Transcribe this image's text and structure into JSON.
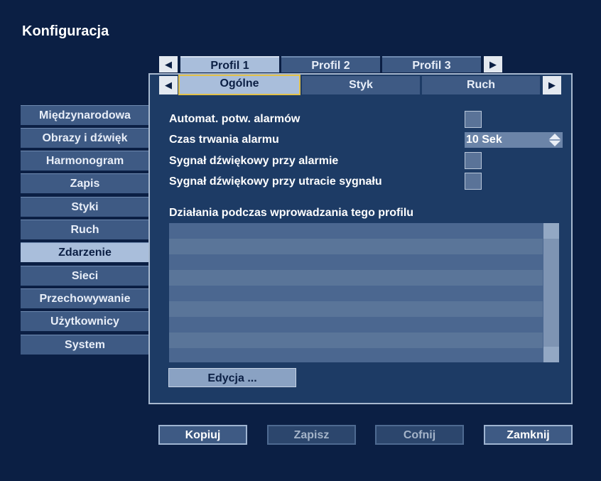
{
  "window": {
    "title": "Konfiguracja"
  },
  "profile_tabs": [
    {
      "label": "Profil 1",
      "active": true
    },
    {
      "label": "Profil 2",
      "active": false
    },
    {
      "label": "Profil 3",
      "active": false
    }
  ],
  "sub_tabs": [
    {
      "label": "Ogólne",
      "active": true
    },
    {
      "label": "Styk",
      "active": false
    },
    {
      "label": "Ruch",
      "active": false
    }
  ],
  "sidebar": {
    "items": [
      {
        "label": "Międzynarodowa"
      },
      {
        "label": "Obrazy i dźwięk"
      },
      {
        "label": "Harmonogram"
      },
      {
        "label": "Zapis"
      },
      {
        "label": "Styki"
      },
      {
        "label": "Ruch"
      },
      {
        "label": "Zdarzenie",
        "active": true
      },
      {
        "label": "Sieci"
      },
      {
        "label": "Przechowywanie"
      },
      {
        "label": "Użytkownicy"
      },
      {
        "label": "System"
      }
    ]
  },
  "settings": {
    "auto_confirm_label": "Automat. potw. alarmów",
    "alarm_duration_label": "Czas trwania alarmu",
    "alarm_duration_value": "10 Sek",
    "alarm_beep_label": "Sygnał dźwiękowy przy alarmie",
    "signal_loss_beep_label": "Sygnał dźwiękowy przy utracie sygnału"
  },
  "actions": {
    "section_label": "Działania podczas wprowadzania tego profilu",
    "edit_button": "Edycja ..."
  },
  "bottom_buttons": {
    "copy": "Kopiuj",
    "save": "Zapisz",
    "undo": "Cofnij",
    "close": "Zamknij"
  },
  "icons": {
    "tab_prev": "triangle-left-icon",
    "tab_next": "triangle-right-icon",
    "spinner": "up-down-diamond-icon"
  },
  "colors": {
    "background": "#0b1f44",
    "panel": "#1d3b65",
    "active_tab": "#a9bedb",
    "focus_border": "#e2c14a"
  }
}
